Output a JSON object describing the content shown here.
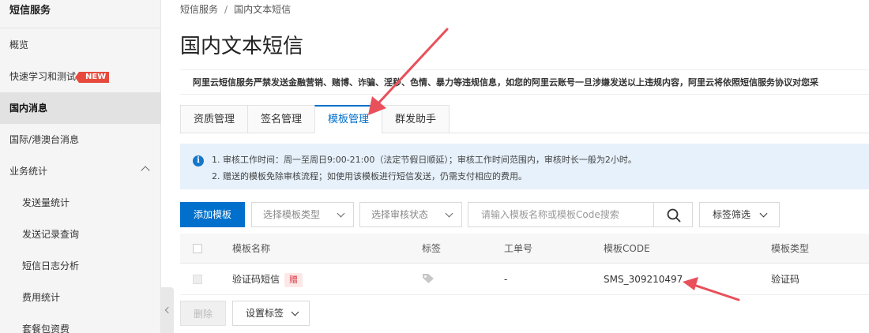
{
  "sidebar": {
    "title": "短信服务",
    "items": [
      {
        "label": "概览"
      },
      {
        "label": "快速学习和测试",
        "badge": "NEW"
      },
      {
        "label": "国内消息"
      },
      {
        "label": "国际/港澳台消息"
      },
      {
        "label": "业务统计"
      },
      {
        "label": "发送量统计"
      },
      {
        "label": "发送记录查询"
      },
      {
        "label": "短信日志分析"
      },
      {
        "label": "费用统计"
      },
      {
        "label": "套餐包资费"
      }
    ]
  },
  "breadcrumb": {
    "root": "短信服务",
    "separator": "/",
    "current": "国内文本短信"
  },
  "page_title": "国内文本短信",
  "notice": "阿里云短信服务严禁发送金融营销、赌博、诈骗、淫秽、色情、暴力等违规信息，如您的阿里云账号一旦涉嫌发送以上违规内容，阿里云将依照短信服务协议对您采",
  "tabs": [
    {
      "label": "资质管理"
    },
    {
      "label": "签名管理"
    },
    {
      "label": "模板管理"
    },
    {
      "label": "群发助手"
    }
  ],
  "info": {
    "line1": "1. 审核工作时间：周一至周日9:00-21:00（法定节假日顺延）；审核工作时间范围内，审核时长一般为2小时。",
    "line2": "2. 赠送的模板免除审核流程；如使用该模板进行短信发送，仍需支付相应的费用。"
  },
  "toolbar": {
    "add_label": "添加模板",
    "type_placeholder": "选择模板类型",
    "status_placeholder": "选择审核状态",
    "search_placeholder": "请输入模板名称或模板Code搜索",
    "tag_filter_label": "标签筛选"
  },
  "table": {
    "columns": [
      "模板名称",
      "标签",
      "工单号",
      "模板CODE",
      "模板类型"
    ],
    "rows": [
      {
        "name": "验证码短信",
        "gift_badge": "赠",
        "ticket": "-",
        "code": "SMS_309210497",
        "type": "验证码"
      }
    ]
  },
  "bottom": {
    "delete_label": "删除",
    "set_tag_label": "设置标签"
  },
  "colors": {
    "primary": "#0070cc",
    "annotation_arrow": "#e8505b",
    "new_badge": "#e74a3c"
  }
}
